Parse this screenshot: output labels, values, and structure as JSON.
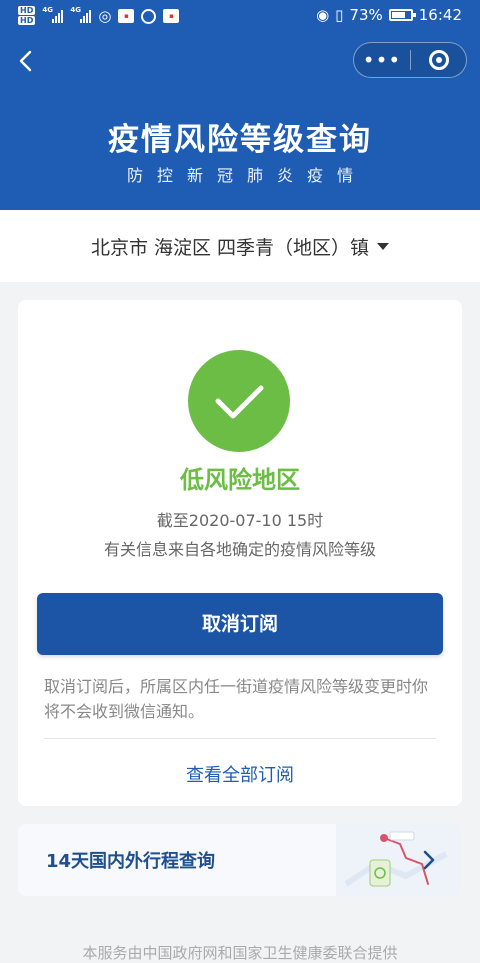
{
  "status_bar": {
    "hd1": "HD",
    "hd2": "HD",
    "net1": "4G",
    "net2": "4G",
    "battery_percent": "73%",
    "battery_level": 0.73,
    "time": "16:42"
  },
  "nav": {
    "back_icon": "chevron-left-icon",
    "more_label": "•••",
    "close_icon": "target-icon"
  },
  "header": {
    "title": "疫情风险等级查询",
    "subtitle": "防控新冠肺炎疫情"
  },
  "location": {
    "text": "北京市 海淀区 四季青（地区）镇"
  },
  "result": {
    "risk_level": "低风险地区",
    "as_of": "截至2020-07-10 15时",
    "source_note": "有关信息来自各地确定的疫情风险等级",
    "unsubscribe_label": "取消订阅",
    "unsubscribe_note": "取消订阅后，所属区内任一街道疫情风险等级变更时你将不会收到微信通知。",
    "view_all_label": "查看全部订阅",
    "accent_green": "#6bbd45",
    "accent_blue": "#1e5db3"
  },
  "trip": {
    "label": "14天国内外行程查询"
  },
  "footer": {
    "text": "本服务由中国政府网和国家卫生健康委联合提供"
  }
}
